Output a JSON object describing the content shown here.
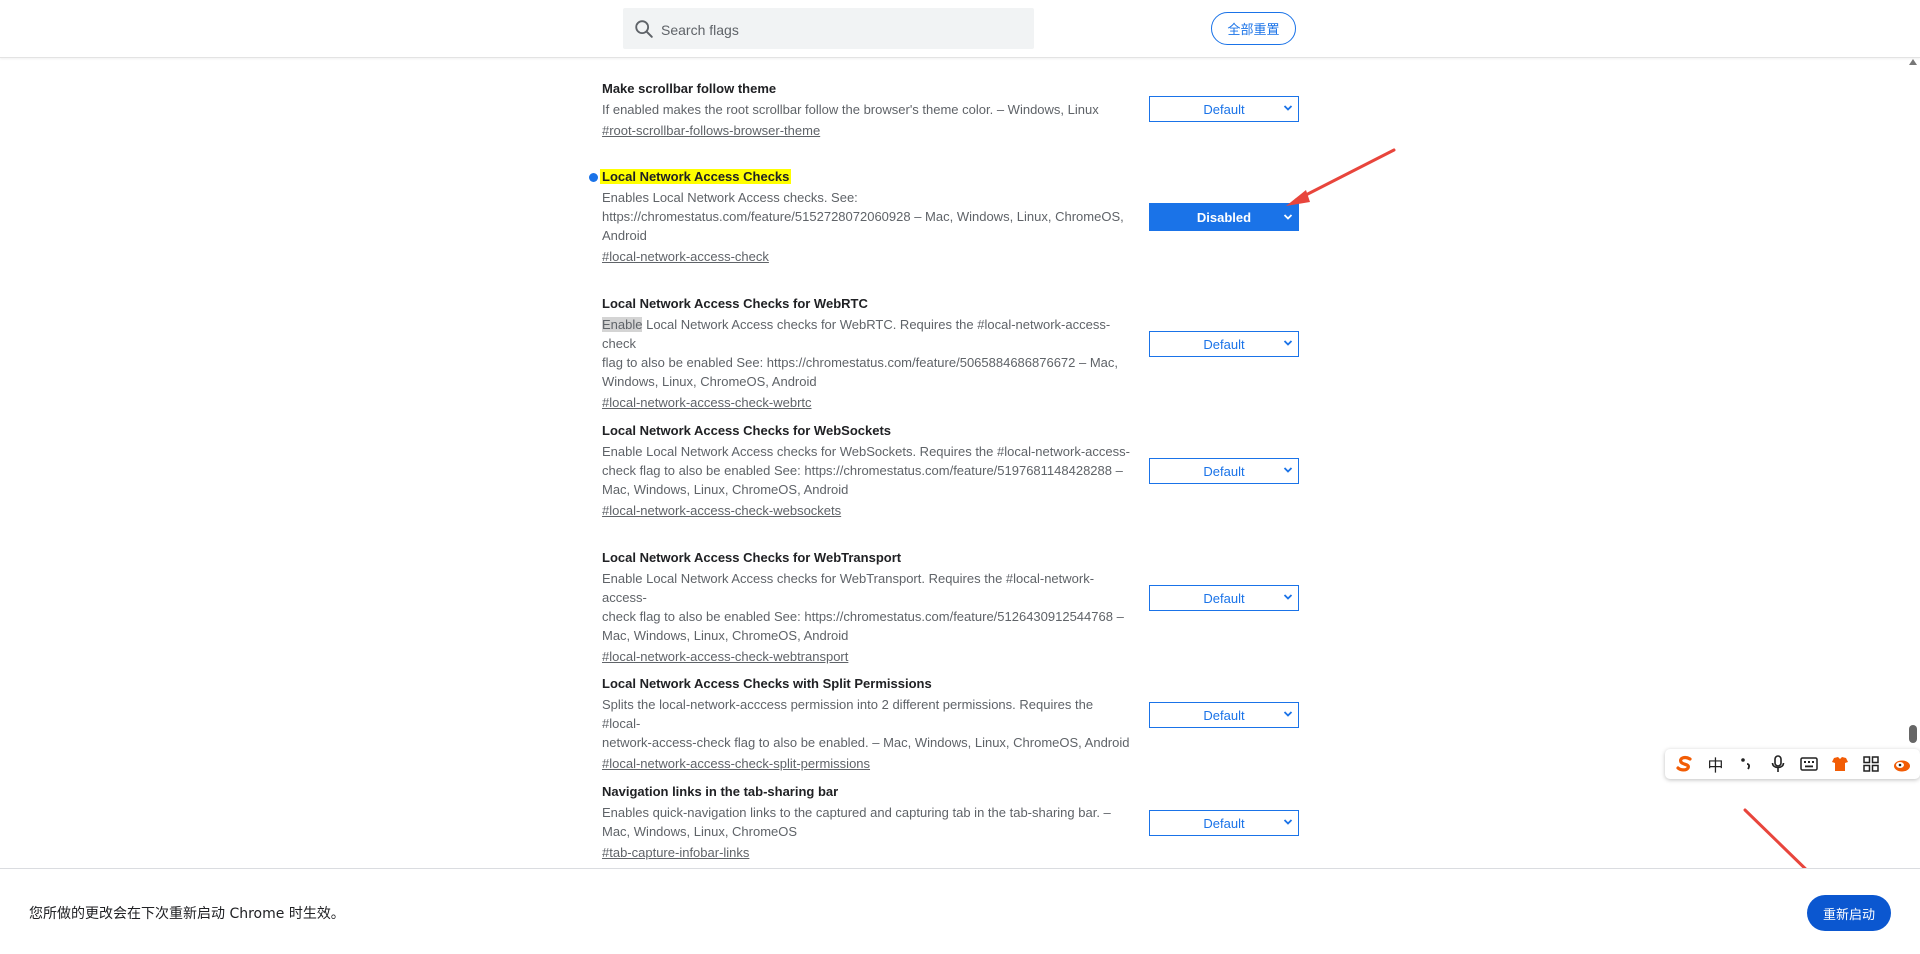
{
  "header": {
    "search_placeholder": "Search flags",
    "reset_all_label": "全部重置"
  },
  "flags": [
    {
      "title": "Make scrollbar follow theme",
      "desc": "If enabled makes the root scrollbar follow the browser's theme color. – Windows, Linux",
      "link": "#root-scrollbar-follows-browser-theme",
      "value": "Default"
    },
    {
      "title": "Local Network Access Checks",
      "desc_lines": [
        "Enables Local Network Access checks. See:",
        "https://chromestatus.com/feature/5152728072060928 – Mac, Windows, Linux, ChromeOS,",
        "Android"
      ],
      "link": "#local-network-access-check",
      "value": "Disabled"
    },
    {
      "title": "Local Network Access Checks for WebRTC",
      "desc_sel": "Enable",
      "desc_lines": [
        " Local Network Access checks for WebRTC. Requires the #local-network-access-check",
        "flag to also be enabled See: https://chromestatus.com/feature/5065884686876672 – Mac,",
        "Windows, Linux, ChromeOS, Android"
      ],
      "link": "#local-network-access-check-webrtc",
      "value": "Default"
    },
    {
      "title": "Local Network Access Checks for WebSockets",
      "desc_lines": [
        "Enable Local Network Access checks for WebSockets. Requires the #local-network-access-",
        "check flag to also be enabled See: https://chromestatus.com/feature/5197681148428288 –",
        "Mac, Windows, Linux, ChromeOS, Android"
      ],
      "link": "#local-network-access-check-websockets",
      "value": "Default"
    },
    {
      "title": "Local Network Access Checks for WebTransport",
      "desc_lines": [
        "Enable Local Network Access checks for WebTransport. Requires the #local-network-access-",
        "check flag to also be enabled See: https://chromestatus.com/feature/5126430912544768 –",
        "Mac, Windows, Linux, ChromeOS, Android"
      ],
      "link": "#local-network-access-check-webtransport",
      "value": "Default"
    },
    {
      "title": "Local Network Access Checks with Split Permissions",
      "desc_lines": [
        "Splits the local-network-acccess permission into 2 different permissions. Requires the #local-",
        "network-access-check flag to also be enabled. – Mac, Windows, Linux, ChromeOS, Android"
      ],
      "link": "#local-network-access-check-split-permissions",
      "value": "Default"
    },
    {
      "title": "Navigation links in the tab-sharing bar",
      "desc_lines": [
        "Enables quick-navigation links to the captured and capturing tab in the tab-sharing bar. –",
        "Mac, Windows, Linux, ChromeOS"
      ],
      "link": "#tab-capture-infobar-links",
      "value": "Default"
    }
  ],
  "footer": {
    "message": "您所做的更改会在下次重新启动 Chrome 时生效。",
    "restart_label": "重新启动"
  },
  "ime": {
    "mode_label": "中"
  },
  "colors": {
    "accent": "#1a73e8",
    "highlight": "#ffff00",
    "restart_button": "#0b57d0",
    "annotation_arrow": "#e8453c"
  }
}
